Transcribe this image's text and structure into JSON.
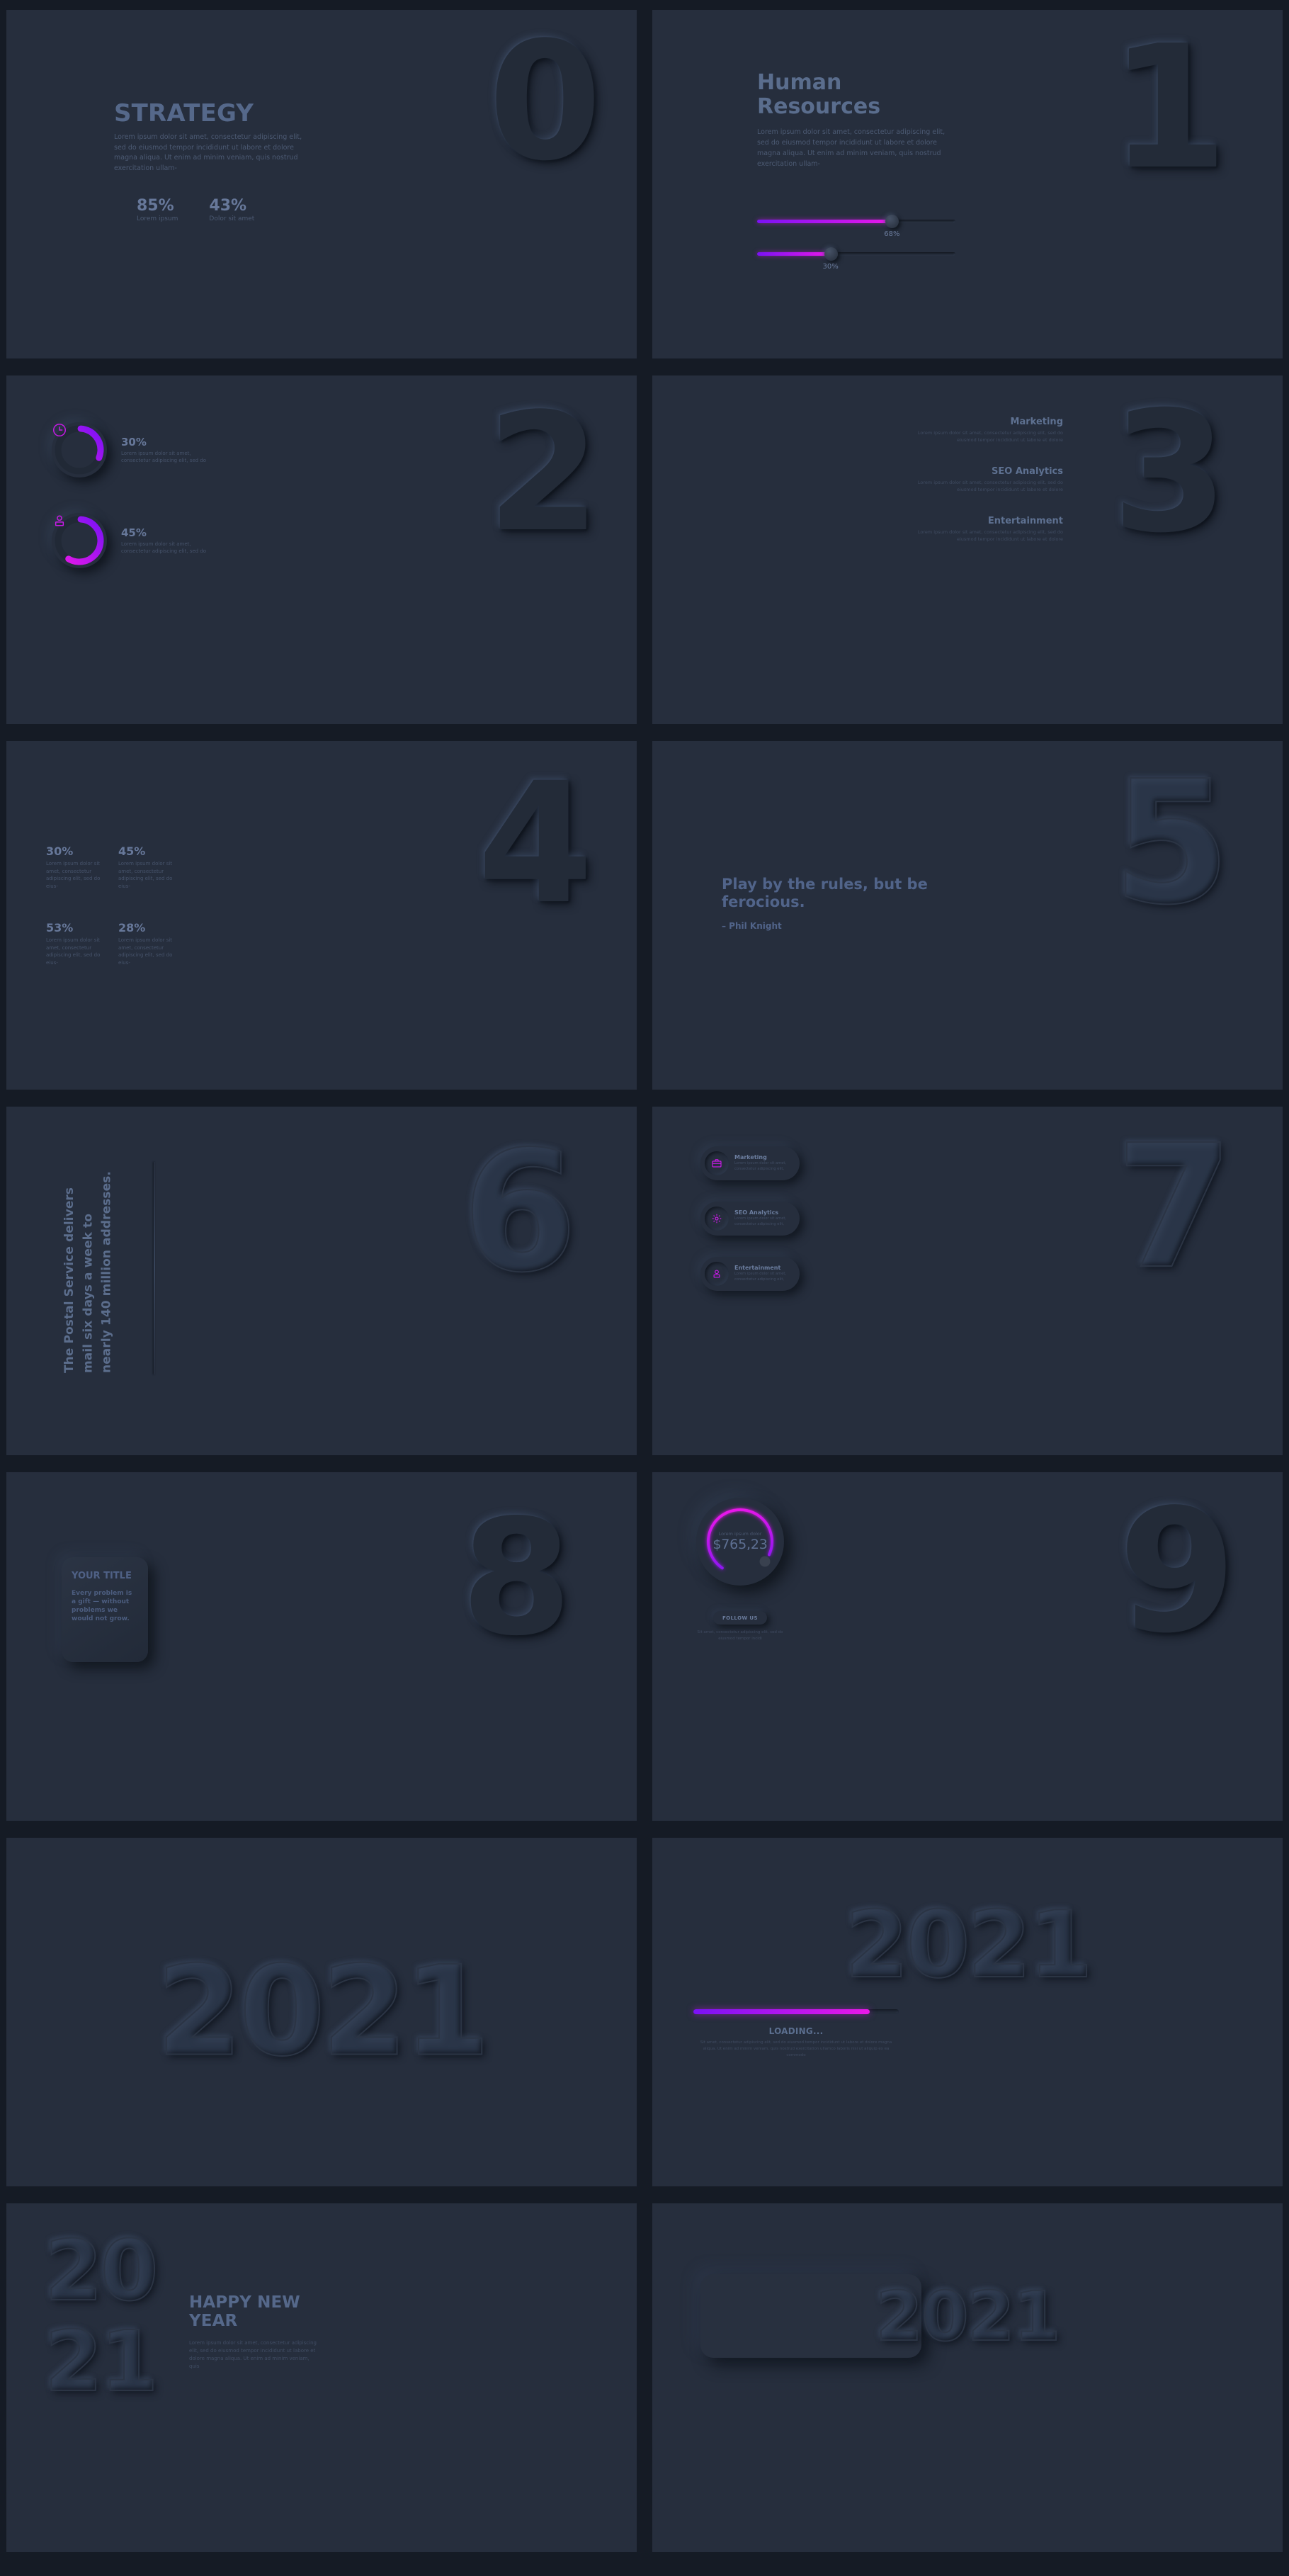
{
  "theme": {
    "page_bg": "#151b25",
    "slide_bg": "#262e3d",
    "accent_start": "#7a12f5",
    "accent_end": "#ea18e8",
    "text_strong": "#5b6e8e",
    "text_body": "#4c5a73"
  },
  "lorem": {
    "long": "Lorem ipsum dolor sit amet, consectetur adipiscing elit, sed do eiusmod tempor incididunt ut labore et dolore magna aliqua. Ut enim ad minim veniam, quis nostrud exercitation ullam-",
    "med": "Lorem ipsum dolor sit amet, consectetur adipiscing elit, sed do",
    "med2": "Lorem ipsum dolor sit amet, consectetur adipiscing elit, sed do eius-",
    "right": "Lorem ipsum dolor sit amet, consectetur adipiscing elit, sed do eiusmod tempor incididunt ut labore et dolore",
    "pill": "Lorem ipsum dolor sit amet, consectetur adipiscing elit,",
    "follow": "Sit amet, consectetur adipiscing elit, sed do eiusmod tempor incidi",
    "loading": "Sit amet, consectetur adipiscing elit, sed do eiusmod tempor incididunt ut labore et dolore magna aliqua. Ut enim ad minim veniam, quis nostrud exercitation ullamco laboris nisi ut aliquip ex ea commodo",
    "newyear": "Lorem ipsum dolor sit amet, consectetur adipiscing elit, sed do eiusmod tempor incididunt ut labore et dolore magna aliqua. Ut enim ad minim veniam, quis"
  },
  "slides": [
    {
      "numeral": "0",
      "title": "STRATEGY",
      "paragraph": "Lorem ipsum dolor sit amet, consectetur adipiscing elit, sed do eiusmod tempor incididunt ut labore et dolore magna aliqua. Ut enim ad minim veniam, quis nostrud exercitation ullam-",
      "stats": [
        {
          "value": "85%",
          "label": "Lorem ipsum"
        },
        {
          "value": "43%",
          "label": "Dolor sit amet"
        }
      ]
    },
    {
      "numeral": "1",
      "title": "Human Resources",
      "paragraph": "Lorem ipsum dolor sit amet, consectetur adipiscing elit, sed do eiusmod tempor incididunt ut labore et dolore magna aliqua. Ut enim ad minim veniam, quis nostrud exercitation ullam-",
      "sliders": [
        {
          "value": "68%",
          "pct": 68
        },
        {
          "value": "30%",
          "pct": 30
        }
      ]
    },
    {
      "numeral": "2",
      "rings": [
        {
          "value": "30%",
          "pct": 30,
          "icon": "clock-icon",
          "desc": "Lorem ipsum dolor sit amet, consectetur adipiscing elit, sed do"
        },
        {
          "value": "45%",
          "pct": 45,
          "icon": "person-icon",
          "desc": "Lorem ipsum dolor sit amet, consectetur adipiscing elit, sed do"
        }
      ]
    },
    {
      "numeral": "3",
      "items": [
        {
          "title": "Marketing",
          "desc": "Lorem ipsum dolor sit amet, consectetur adipiscing elit, sed do eiusmod tempor incididunt ut labore et dolore"
        },
        {
          "title": "SEO Analytics",
          "desc": "Lorem ipsum dolor sit amet, consectetur adipiscing elit, sed do eiusmod tempor incididunt ut labore et dolore"
        },
        {
          "title": "Entertainment",
          "desc": "Lorem ipsum dolor sit amet, consectetur adipiscing elit, sed do eiusmod tempor incididunt ut labore et dolore"
        }
      ]
    },
    {
      "numeral": "4",
      "stats": [
        {
          "value": "30%",
          "desc": "Lorem ipsum dolor sit amet, consectetur adipiscing elit, sed do eius-"
        },
        {
          "value": "45%",
          "desc": "Lorem ipsum dolor sit amet, consectetur adipiscing elit, sed do eius-"
        },
        {
          "value": "53%",
          "desc": "Lorem ipsum dolor sit amet, consectetur adipiscing elit, sed do eius-"
        },
        {
          "value": "28%",
          "desc": "Lorem ipsum dolor sit amet, consectetur adipiscing elit, sed do eius-"
        }
      ]
    },
    {
      "numeral": "5",
      "quote": "Play by the rules, but be ferocious.",
      "author": "– Phil Knight"
    },
    {
      "numeral": "6",
      "vertical_text": "The Postal Service delivers mail six days a week to nearly 140 million addresses."
    },
    {
      "numeral": "7",
      "pills": [
        {
          "title": "Marketing",
          "desc": "Lorem ipsum dolor sit amet, consectetur adipiscing elit,",
          "icon": "briefcase-icon"
        },
        {
          "title": "SEO Analytics",
          "desc": "Lorem ipsum dolor sit amet, consectetur adipiscing elit,",
          "icon": "gear-icon"
        },
        {
          "title": "Entertainment",
          "desc": "Lorem ipsum dolor sit amet, consectetur adipiscing elit,",
          "icon": "person-icon"
        }
      ]
    },
    {
      "numeral": "8",
      "card": {
        "title": "YOUR TITLE",
        "body": "Every problem is a gift — without problems we would not grow."
      }
    },
    {
      "numeral": "9",
      "gauge": {
        "label": "Lorem ipsum dolor",
        "amount": "$765,23",
        "pct": 72
      },
      "button_label": "FOLLOW US",
      "caption": "Sit amet, consectetur adipiscing elit, sed do eiusmod tempor incidi"
    },
    {
      "numeral": "2021"
    },
    {
      "numeral": "2021",
      "progress_pct": 86,
      "loading_title": "LOADING...",
      "loading_desc": "Sit amet, consectetur adipiscing elit, sed do eiusmod tempor incididunt ut labore et dolore magna aliqua. Ut enim ad minim veniam, quis nostrud exercitation ullamco laboris nisi ut aliquip ex ea commodo"
    },
    {
      "numeral_line1": "20",
      "numeral_line2": "21",
      "title": "HAPPY NEW YEAR",
      "desc": "Lorem ipsum dolor sit amet, consectetur adipiscing elit, sed do eiusmod tempor incididunt ut labore et dolore magna aliqua. Ut enim ad minim veniam, quis"
    },
    {
      "numeral": "2021"
    }
  ]
}
